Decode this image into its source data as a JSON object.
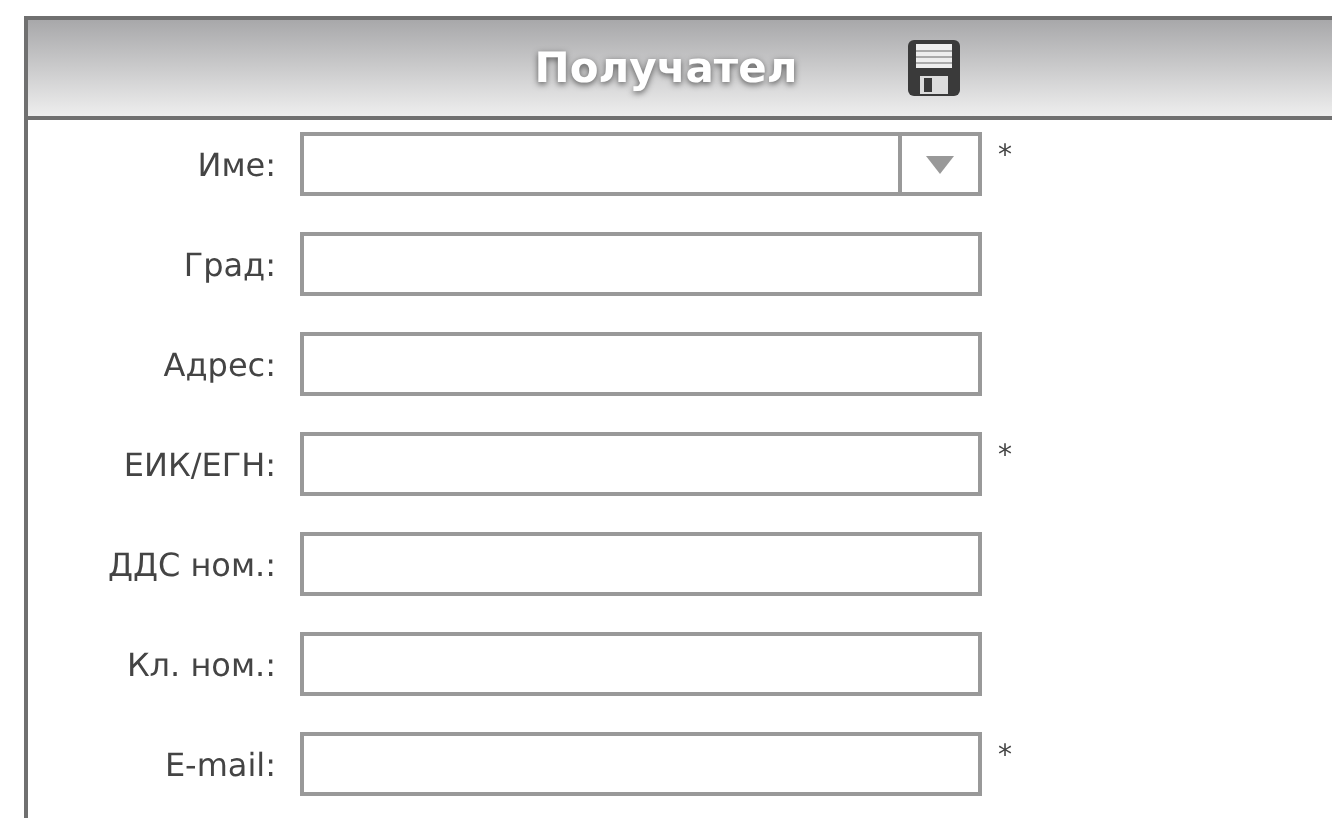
{
  "panel": {
    "title": "Получател"
  },
  "fields": [
    {
      "label": "Име:",
      "kind": "dropdown",
      "mark": "*"
    },
    {
      "label": "Град:",
      "kind": "text"
    },
    {
      "label": "Адрес:",
      "kind": "text"
    },
    {
      "label": "ЕИК/ЕГН:",
      "kind": "text",
      "mark": "*"
    },
    {
      "label": "ДДС ном.:",
      "kind": "text"
    },
    {
      "label": "Кл. ном.:",
      "kind": "text"
    },
    {
      "label": "E-mail:",
      "kind": "text",
      "mark": "*"
    }
  ]
}
